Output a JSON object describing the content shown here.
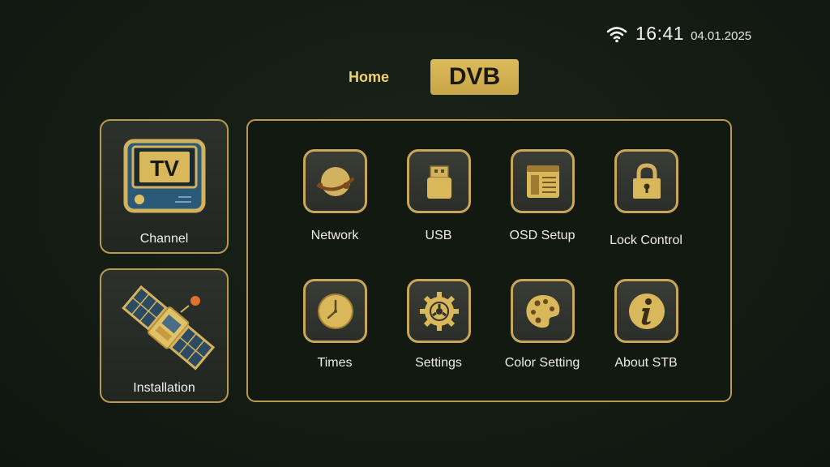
{
  "status": {
    "wifi_icon": "wifi-icon",
    "time": "16:41",
    "date": "04.01.2025"
  },
  "tabs": {
    "home": "Home",
    "dvb": "DVB"
  },
  "side": {
    "channel": {
      "label": "Channel",
      "icon": "tv-icon",
      "icon_text": "TV"
    },
    "installation": {
      "label": "Installation",
      "icon": "satellite-icon"
    }
  },
  "menu": {
    "items": [
      {
        "label": "Network",
        "icon": "network-icon"
      },
      {
        "label": "USB",
        "icon": "usb-icon"
      },
      {
        "label": "OSD Setup",
        "icon": "osd-setup-icon"
      },
      {
        "label": "Lock Control",
        "icon": "lock-icon"
      },
      {
        "label": "Times",
        "icon": "clock-icon"
      },
      {
        "label": "Settings",
        "icon": "gear-icon"
      },
      {
        "label": "Color Setting",
        "icon": "palette-icon"
      },
      {
        "label": "About STB",
        "icon": "info-icon"
      }
    ]
  },
  "colors": {
    "gold": "#c9a547",
    "accent_text": "#f1cf6a",
    "background": "#141c13",
    "border": "#b99950"
  }
}
